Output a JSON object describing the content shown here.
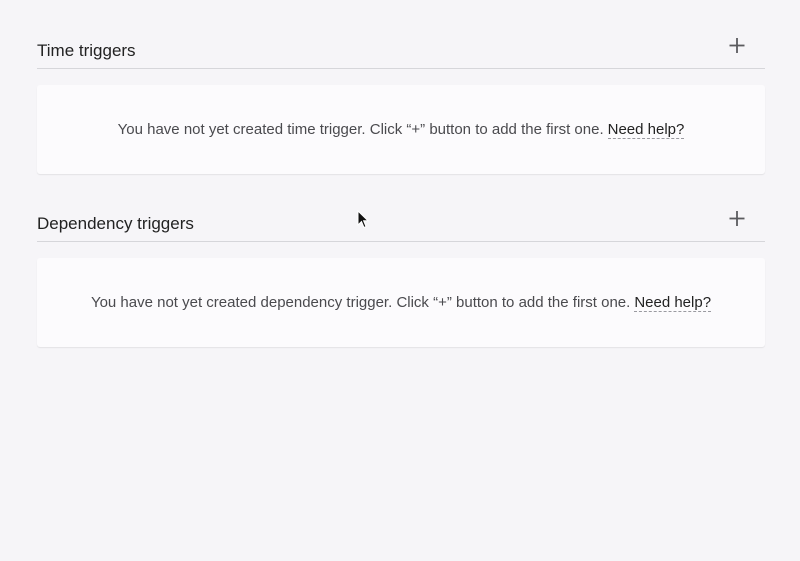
{
  "time_triggers": {
    "title": "Time triggers",
    "add_icon": "plus-icon",
    "empty_message": "You have not yet created time trigger. Click “+” button to add the first one.",
    "help_link": "Need help?"
  },
  "dependency_triggers": {
    "title": "Dependency triggers",
    "add_icon": "plus-icon",
    "empty_message": "You have not yet created dependency trigger. Click “+” button to add the first one.",
    "help_link": "Need help?"
  },
  "colors": {
    "background": "#f6f5f8",
    "card": "#fcfbfd",
    "divider": "#d6d6da",
    "icon": "#5a5a5e"
  },
  "cursor_icon": "mouse-pointer-icon"
}
